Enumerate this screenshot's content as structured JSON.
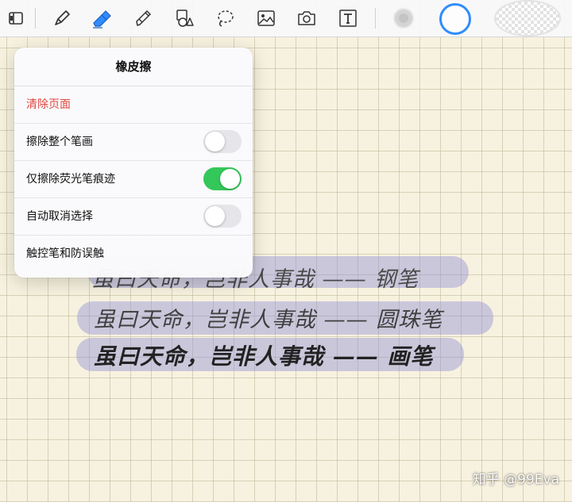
{
  "toolbar": {
    "tools": [
      {
        "name": "pages-icon"
      },
      {
        "name": "pen-icon"
      },
      {
        "name": "eraser-icon"
      },
      {
        "name": "highlighter-icon"
      },
      {
        "name": "shapes-icon"
      },
      {
        "name": "lasso-icon"
      },
      {
        "name": "image-icon"
      },
      {
        "name": "camera-icon"
      },
      {
        "name": "text-icon"
      }
    ],
    "active_tool": "eraser-icon",
    "colors": [
      "#cccccc",
      "#2f8cff",
      "#ffffff"
    ]
  },
  "popover": {
    "title": "橡皮擦",
    "clear_page": "清除页面",
    "rows": [
      {
        "label": "擦除整个笔画",
        "on": false
      },
      {
        "label": "仅擦除荧光笔痕迹",
        "on": true
      },
      {
        "label": "自动取消选择",
        "on": false
      }
    ],
    "stylus": "触控笔和防误触"
  },
  "notes": {
    "line1": "虽曰天命，岂非人事哉 —— 钢笔",
    "line2": "虽曰天命，岂非人事哉 —— 圆珠笔",
    "line3": "虽曰天命，岂非人事哉 —— 画笔"
  },
  "watermark": "知乎 @99Eva",
  "colors": {
    "toggle_on": "#34c759",
    "danger": "#e0473e",
    "highlight": "#8c8cd7"
  }
}
